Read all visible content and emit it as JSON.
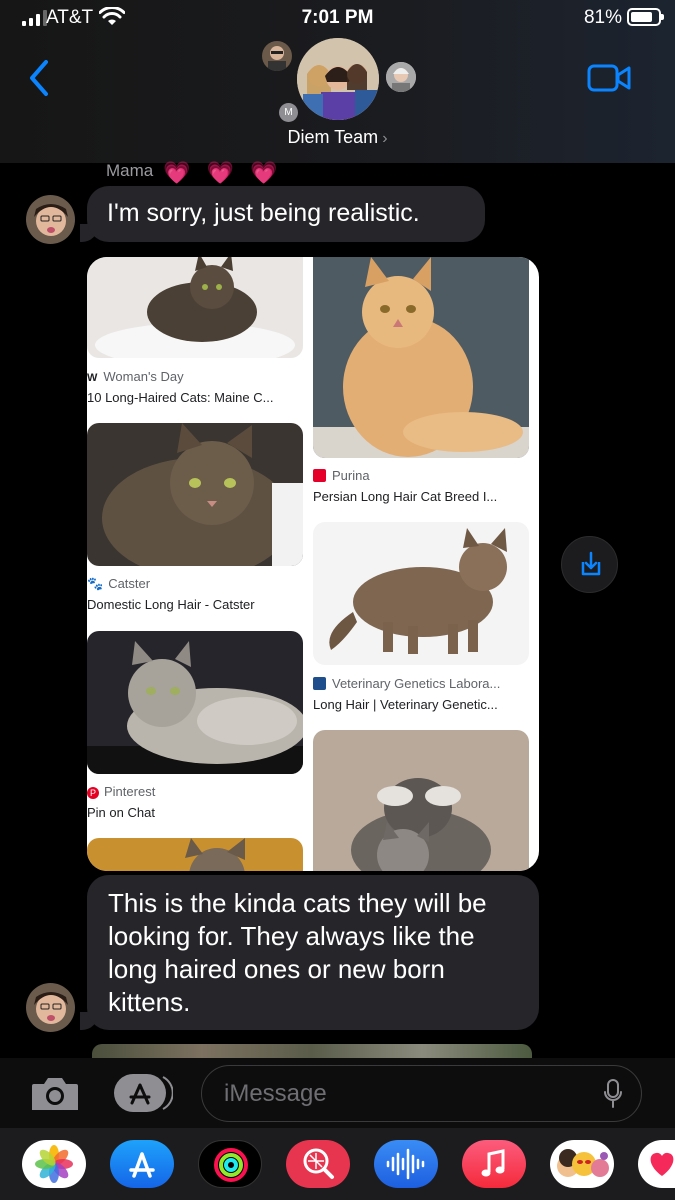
{
  "status_bar": {
    "carrier": "AT&T",
    "time": "7:01 PM",
    "battery": "81%"
  },
  "header": {
    "group_name": "Diem Team",
    "chevron": "›",
    "initial_badge": "M"
  },
  "messages": [
    {
      "sender": "Mama",
      "sender_decoration": "💗 💗 💗",
      "text": "I'm sorry, just being realistic."
    },
    {
      "type": "image-grid",
      "results": [
        {
          "source": "Woman's Day",
          "source_icon": "W",
          "title": "10 Long-Haired Cats: Maine C..."
        },
        {
          "source": "Purina",
          "title": "Persian Long Hair Cat Breed I..."
        },
        {
          "source": "Catster",
          "source_icon": "🐾",
          "title": "Domestic Long Hair - Catster"
        },
        {
          "source": "Veterinary Genetics Labora...",
          "title": "Long Hair | Veterinary Genetic..."
        },
        {
          "source": "Pinterest",
          "source_icon": "P",
          "title": "Pin on Chat"
        }
      ]
    },
    {
      "text": "This is the kinda cats they will be looking for. They always like the long haired ones or new born kittens."
    }
  ],
  "composer": {
    "placeholder": "iMessage"
  },
  "app_drawer": [
    "photos-app",
    "app-store-app",
    "activity-app",
    "images-search-app",
    "audio-message-app",
    "music-app",
    "memoji-app",
    "digital-touch-app"
  ],
  "colors": {
    "accent": "#0a84ff",
    "bubble": "#26252a",
    "heart": "#ff2ea6"
  }
}
